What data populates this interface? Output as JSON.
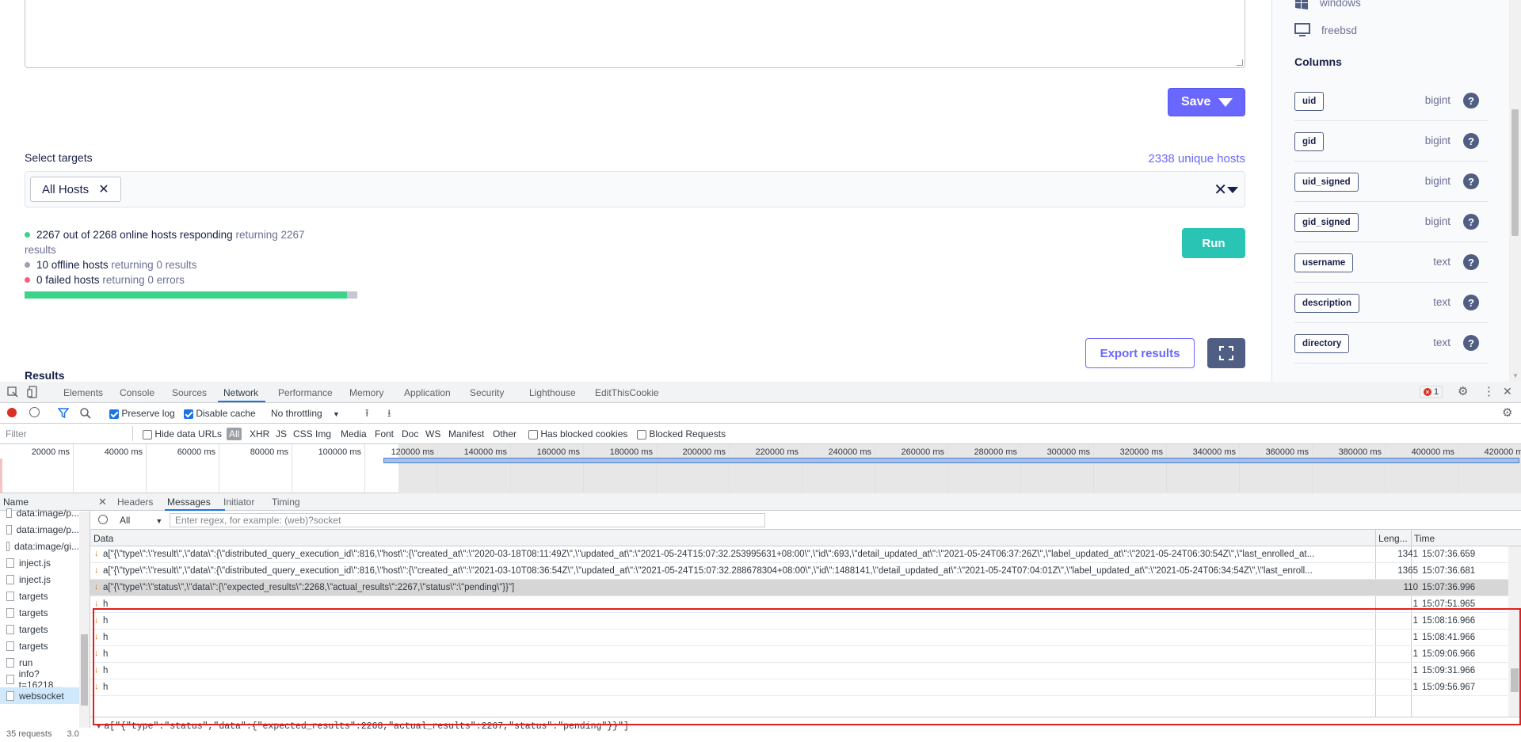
{
  "app": {
    "save_label": "Save",
    "select_targets_label": "Select targets",
    "unique_hosts": "2338 unique hosts",
    "target_pill": "All Hosts",
    "status": {
      "online_text": "2267 out of 2268 online hosts responding",
      "online_returning": "returning 2267",
      "online_results": "results",
      "offline_text": "10 offline hosts",
      "offline_returning": "returning 0 results",
      "failed_text": "0 failed hosts",
      "failed_returning": "returning 0 errors"
    },
    "progress_fraction": 0.97,
    "run_label": "Run",
    "export_label": "Export results",
    "results_title": "Results",
    "colors": {
      "accent": "#6a67fe",
      "run": "#2ac4b4",
      "online": "#3dd388",
      "offline": "#9ea0ae",
      "failed": "#ff5c83"
    }
  },
  "sidebar": {
    "os_items": [
      {
        "label": "windows",
        "icon": "windows-icon"
      },
      {
        "label": "freebsd",
        "icon": "monitor-icon"
      }
    ],
    "columns_title": "Columns",
    "columns": [
      {
        "name": "uid",
        "type": "bigint"
      },
      {
        "name": "gid",
        "type": "bigint"
      },
      {
        "name": "uid_signed",
        "type": "bigint"
      },
      {
        "name": "gid_signed",
        "type": "bigint"
      },
      {
        "name": "username",
        "type": "text"
      },
      {
        "name": "description",
        "type": "text"
      },
      {
        "name": "directory",
        "type": "text"
      }
    ]
  },
  "devtools": {
    "tabs": [
      "Elements",
      "Console",
      "Sources",
      "Network",
      "Performance",
      "Memory",
      "Application",
      "Security",
      "Lighthouse",
      "EditThisCookie"
    ],
    "active_tab": "Network",
    "error_count": "1",
    "toolbar": {
      "preserve_log": "Preserve log",
      "disable_cache": "Disable cache",
      "throttling": "No throttling"
    },
    "filterbar": {
      "filter_placeholder": "Filter",
      "hide_data_urls": "Hide data URLs",
      "types": [
        "All",
        "XHR",
        "JS",
        "CSS",
        "Img",
        "Media",
        "Font",
        "Doc",
        "WS",
        "Manifest",
        "Other"
      ],
      "has_blocked_cookies": "Has blocked cookies",
      "blocked_requests": "Blocked Requests"
    },
    "overview_ticks": [
      "20000 ms",
      "40000 ms",
      "60000 ms",
      "80000 ms",
      "100000 ms",
      "120000 ms",
      "140000 ms",
      "160000 ms",
      "180000 ms",
      "200000 ms",
      "220000 ms",
      "240000 ms",
      "260000 ms",
      "280000 ms",
      "300000 ms",
      "320000 ms",
      "340000 ms",
      "360000 ms",
      "380000 ms",
      "400000 ms",
      "420000 ms"
    ],
    "requests_header": "Name",
    "requests": [
      "data:image/p...",
      "data:image/p...",
      "data:image/gi...",
      "inject.js",
      "inject.js",
      "targets",
      "targets",
      "targets",
      "targets",
      "run",
      "info?t=16218...",
      "websocket"
    ],
    "footer": "35 requests",
    "footer_size": "3.0",
    "message_tabs": [
      "Headers",
      "Messages",
      "Initiator",
      "Timing"
    ],
    "active_message_tab": "Messages",
    "msg_filter_type": "All",
    "msg_filter_placeholder": "Enter regex, for example: (web)?socket",
    "columns": {
      "data": "Data",
      "length": "Leng...",
      "time": "Time"
    },
    "messages": [
      {
        "data": "a[\"{\\\"type\\\":\\\"result\\\",\\\"data\\\":{\\\"distributed_query_execution_id\\\":816,\\\"host\\\":{\\\"created_at\\\":\\\"2020-03-18T08:11:49Z\\\",\\\"updated_at\\\":\\\"2021-05-24T15:07:32.253995631+08:00\\\",\\\"id\\\":693,\\\"detail_updated_at\\\":\\\"2021-05-24T06:37:26Z\\\",\\\"label_updated_at\\\":\\\"2021-05-24T06:30:54Z\\\",\\\"last_enrolled_at...",
        "length": "1341",
        "time": "15:07:36.659",
        "selected": false
      },
      {
        "data": "a[\"{\\\"type\\\":\\\"result\\\",\\\"data\\\":{\\\"distributed_query_execution_id\\\":816,\\\"host\\\":{\\\"created_at\\\":\\\"2021-03-10T08:36:54Z\\\",\\\"updated_at\\\":\\\"2021-05-24T15:07:32.288678304+08:00\\\",\\\"id\\\":1488141,\\\"detail_updated_at\\\":\\\"2021-05-24T07:04:01Z\\\",\\\"label_updated_at\\\":\\\"2021-05-24T06:34:54Z\\\",\\\"last_enroll...",
        "length": "1365",
        "time": "15:07:36.681",
        "selected": false
      },
      {
        "data": "a[\"{\\\"type\\\":\\\"status\\\",\\\"data\\\":{\\\"expected_results\\\":2268,\\\"actual_results\\\":2267,\\\"status\\\":\\\"pending\\\"}}\"]",
        "length": "110",
        "time": "15:07:36.996",
        "selected": true
      },
      {
        "data": "h",
        "length": "1",
        "time": "15:07:51.965",
        "selected": false
      },
      {
        "data": "h",
        "length": "1",
        "time": "15:08:16.966",
        "selected": false
      },
      {
        "data": "h",
        "length": "1",
        "time": "15:08:41.966",
        "selected": false
      },
      {
        "data": "h",
        "length": "1",
        "time": "15:09:06.966",
        "selected": false
      },
      {
        "data": "h",
        "length": "1",
        "time": "15:09:31.966",
        "selected": false
      },
      {
        "data": "h",
        "length": "1",
        "time": "15:09:56.967",
        "selected": false
      }
    ],
    "preview": "a[\"{\"type\":\"status\",\"data\":{\"expected_results\":2268,\"actual_results\":2267,\"status\":\"pending\"}}\"]"
  }
}
